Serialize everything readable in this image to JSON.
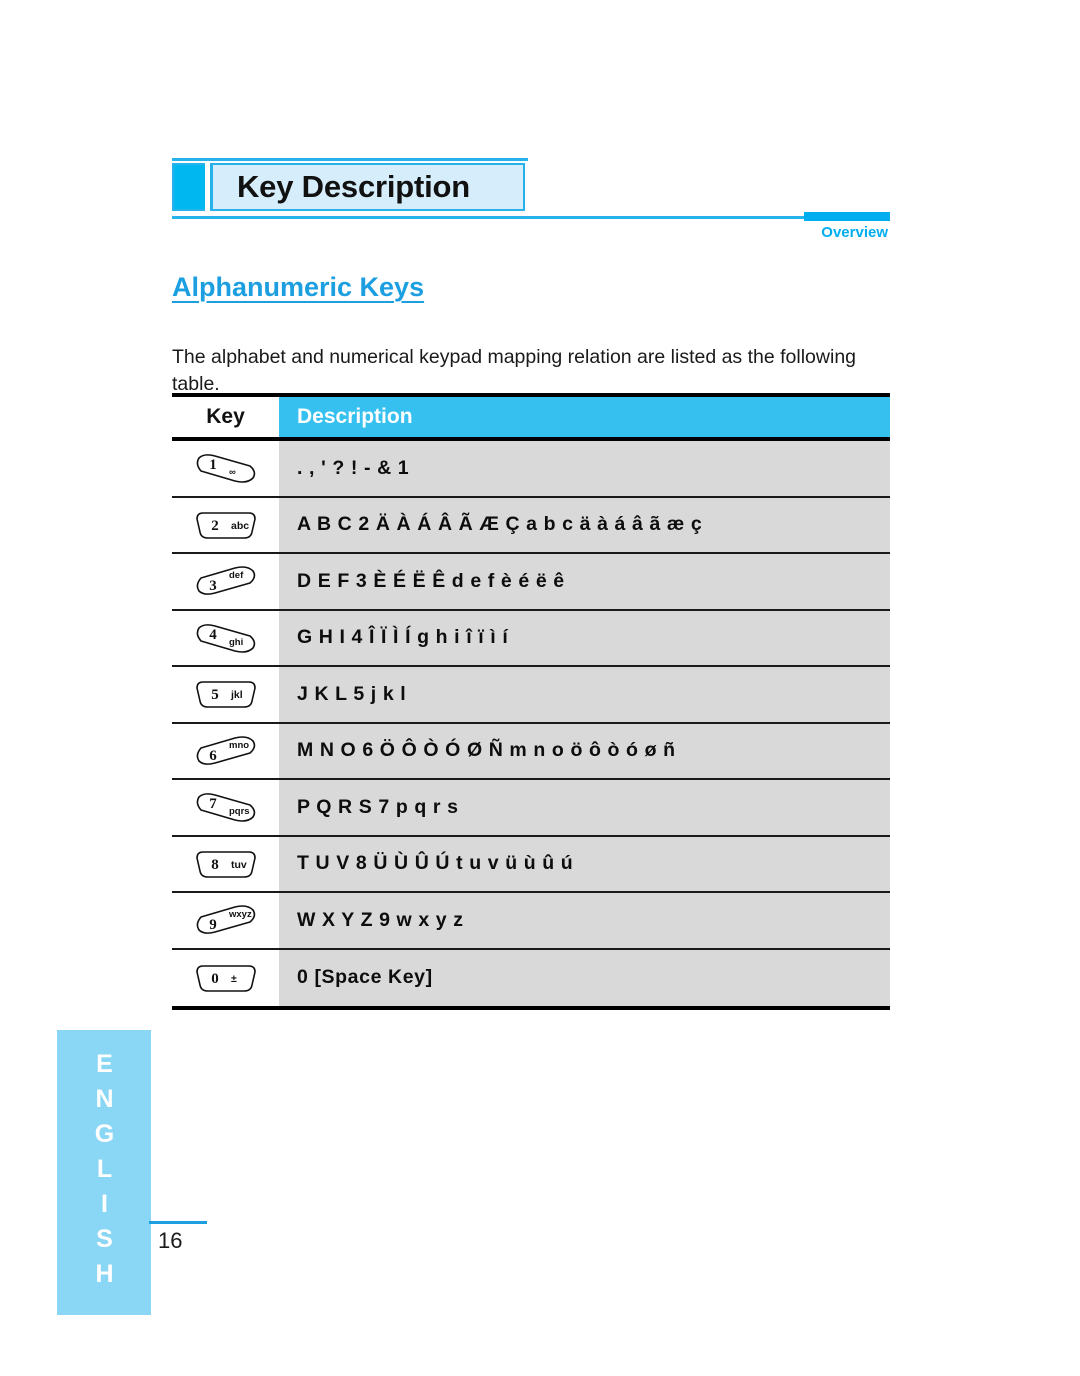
{
  "header": {
    "title": "Key Description",
    "section_tag": "Overview"
  },
  "section": {
    "heading": "Alphanumeric Keys",
    "intro": "The alphabet and numerical keypad mapping relation are listed as the following table."
  },
  "table": {
    "columns": [
      "Key",
      "Description"
    ],
    "rows": [
      {
        "key_digit": "1",
        "key_letters": "∞",
        "key_icon": "keypad-key-1-icon",
        "key_shape": "slant-right",
        "description": ". , ' ? ! - & 1"
      },
      {
        "key_digit": "2",
        "key_letters": "abc",
        "key_icon": "keypad-key-2-icon",
        "key_shape": "flat",
        "description": "A B C 2 Ä À Á Â Ã Æ Ç a b c ä à á â ã æ ç"
      },
      {
        "key_digit": "3",
        "key_letters": "def",
        "key_icon": "keypad-key-3-icon",
        "key_shape": "slant-left",
        "description": "D E F 3 È É Ë Ê d e f è é ë ê"
      },
      {
        "key_digit": "4",
        "key_letters": "ghi",
        "key_icon": "keypad-key-4-icon",
        "key_shape": "slant-right",
        "description": "G H I 4 Î Ï Ì Í g h i î ï ì í"
      },
      {
        "key_digit": "5",
        "key_letters": "jkl",
        "key_icon": "keypad-key-5-icon",
        "key_shape": "flat",
        "description": "J K L 5 j k l"
      },
      {
        "key_digit": "6",
        "key_letters": "mno",
        "key_icon": "keypad-key-6-icon",
        "key_shape": "slant-left",
        "description": "M N O 6 Ö Ô Ò Ó Ø Ñ m n o ö ô ò ó ø ñ"
      },
      {
        "key_digit": "7",
        "key_letters": "pqrs",
        "key_icon": "keypad-key-7-icon",
        "key_shape": "slant-right",
        "description": "P Q R S 7 p q r s"
      },
      {
        "key_digit": "8",
        "key_letters": "tuv",
        "key_icon": "keypad-key-8-icon",
        "key_shape": "flat",
        "description": "T U V 8 Ü Ù Û Ú t u v ü ù û ú"
      },
      {
        "key_digit": "9",
        "key_letters": "wxyz",
        "key_icon": "keypad-key-9-icon",
        "key_shape": "slant-left",
        "description": "W X Y Z 9 w x y z"
      },
      {
        "key_digit": "0",
        "key_letters": "±",
        "key_icon": "keypad-key-0-icon",
        "key_shape": "flat",
        "description": "0 [Space Key]"
      }
    ]
  },
  "sidebar": {
    "language_label": "ENGLISH"
  },
  "footer": {
    "page_number": "16"
  },
  "colors": {
    "accent_cyan": "#00aeef",
    "header_light_blue": "#d6eefb",
    "table_header_cyan": "#35c0f0",
    "row_gray": "#d9d9d9",
    "sidebar_blue": "#8ad6f5",
    "heading_blue": "#1b9fe0"
  }
}
